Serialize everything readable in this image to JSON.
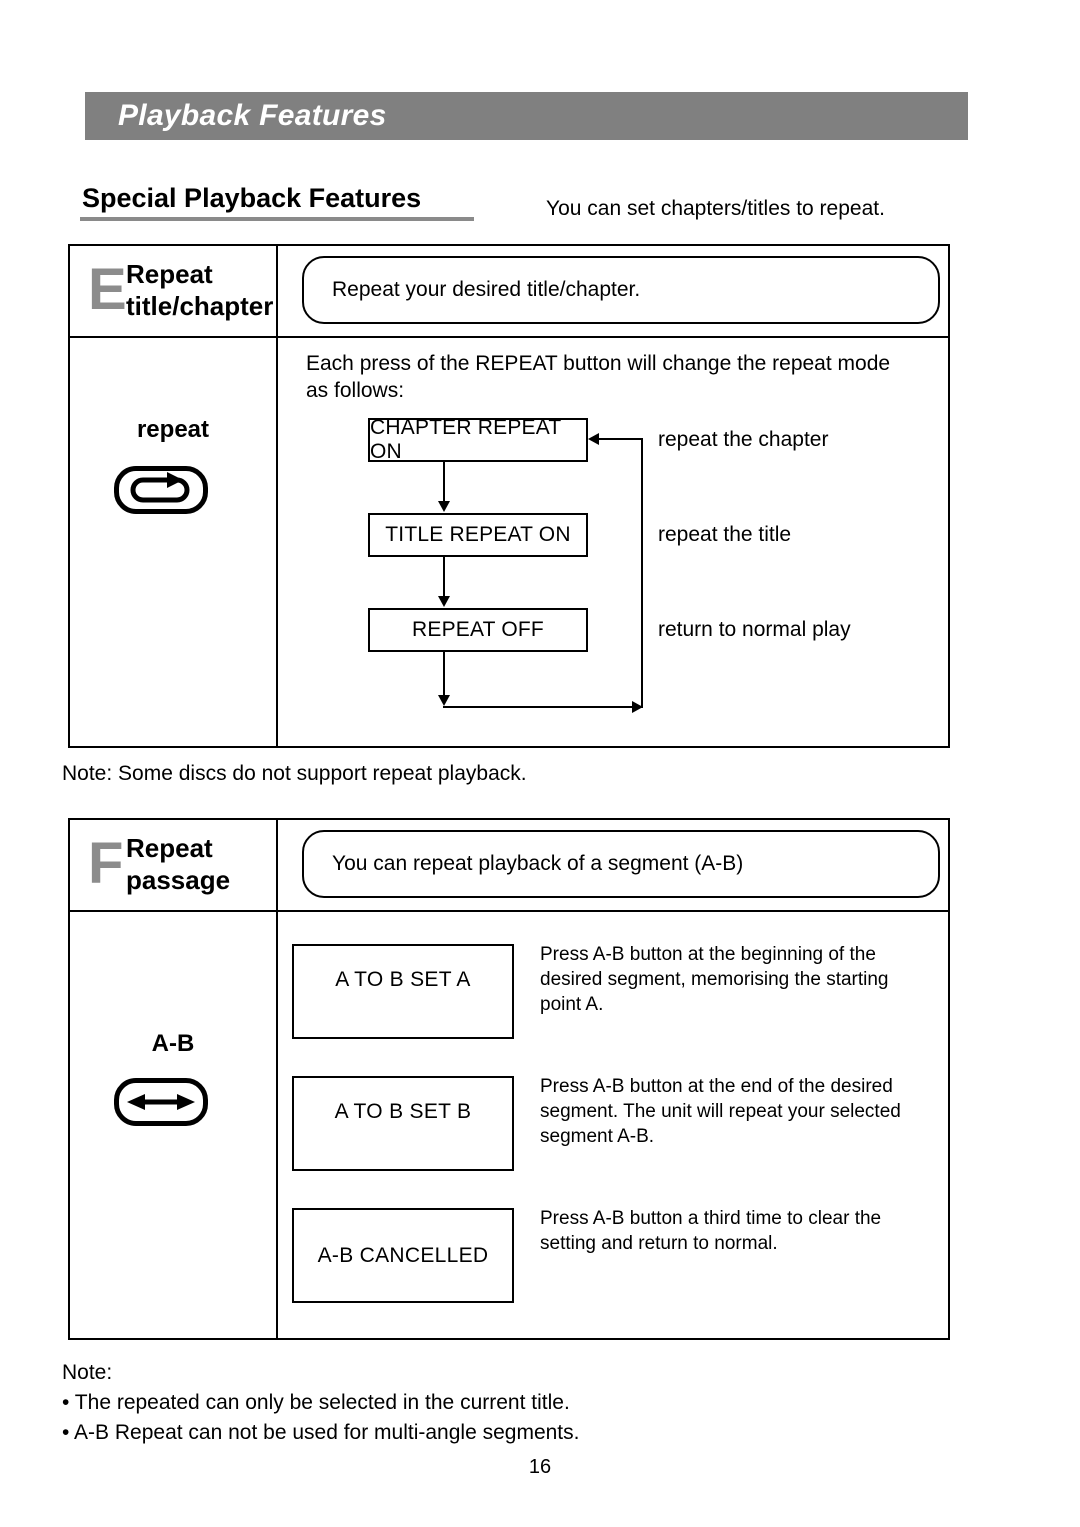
{
  "header": {
    "title": "Playback Features"
  },
  "section": {
    "heading": "Special Playback Features",
    "intro": "You can set chapters/titles to repeat."
  },
  "feature_e": {
    "letter": "E",
    "title_line1": "Repeat",
    "title_line2": "title/chapter",
    "callout": "Repeat your desired title/chapter.",
    "key_label": "repeat",
    "key_icon": "repeat-loop-icon",
    "flow_intro_line1": "Each press of the REPEAT button will change the repeat mode",
    "flow_intro_line2": "as follows:",
    "flow": {
      "steps": [
        {
          "box": "CHAPTER REPEAT ON",
          "label": "repeat the chapter"
        },
        {
          "box": "TITLE REPEAT ON",
          "label": "repeat the title"
        },
        {
          "box": "REPEAT OFF",
          "label": "return to normal play"
        }
      ]
    }
  },
  "mid_note": "Note: Some discs do not support repeat playback.",
  "feature_f": {
    "letter": "F",
    "title_line1": "Repeat",
    "title_line2": "passage",
    "callout": "You can repeat playback of a segment (A-B)",
    "key_label": "A-B",
    "key_icon": "double-arrow-icon",
    "steps": [
      {
        "display": "A TO B     SET A",
        "desc_line1": "Press A-B button at the beginning of the",
        "desc_line2": "desired segment, memorising the starting",
        "desc_line3": "point A."
      },
      {
        "display": "A TO B     SET B",
        "desc_line1": "Press A-B button at the end of the desired",
        "desc_line2": "segment. The unit will repeat your selected",
        "desc_line3": "segment A-B."
      },
      {
        "display": "A-B   CANCELLED",
        "desc_line1": "Press A-B button a third time to clear the",
        "desc_line2": "setting and return to normal.",
        "desc_line3": ""
      }
    ]
  },
  "footer": {
    "note_title": "Note:",
    "bullets": [
      "• The repeated can only be selected in the current title.",
      "• A-B Repeat can not be used for multi-angle segments."
    ],
    "page_number": "16"
  },
  "colors": {
    "banner": "#808080",
    "letter_badge": "#8c8c8c",
    "rule": "#8a8a8a",
    "ink": "#000000"
  }
}
